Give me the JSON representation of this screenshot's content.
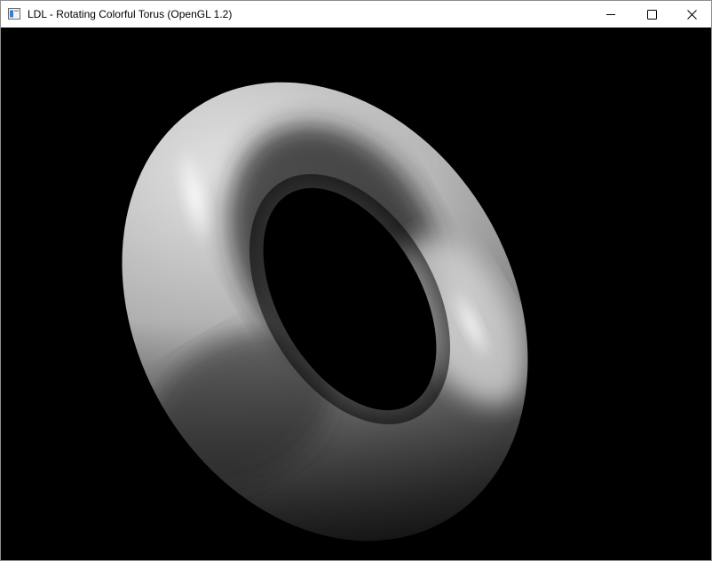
{
  "window": {
    "title": "LDL - Rotating Colorful Torus (OpenGL 1.2)",
    "icon": "app-window-icon"
  },
  "controls": {
    "minimize_icon": "minimize-icon",
    "maximize_icon": "maximize-icon",
    "close_icon": "close-icon"
  },
  "scene": {
    "background_color": "#000000",
    "object": "torus",
    "object_color": "#bdbdbd"
  }
}
